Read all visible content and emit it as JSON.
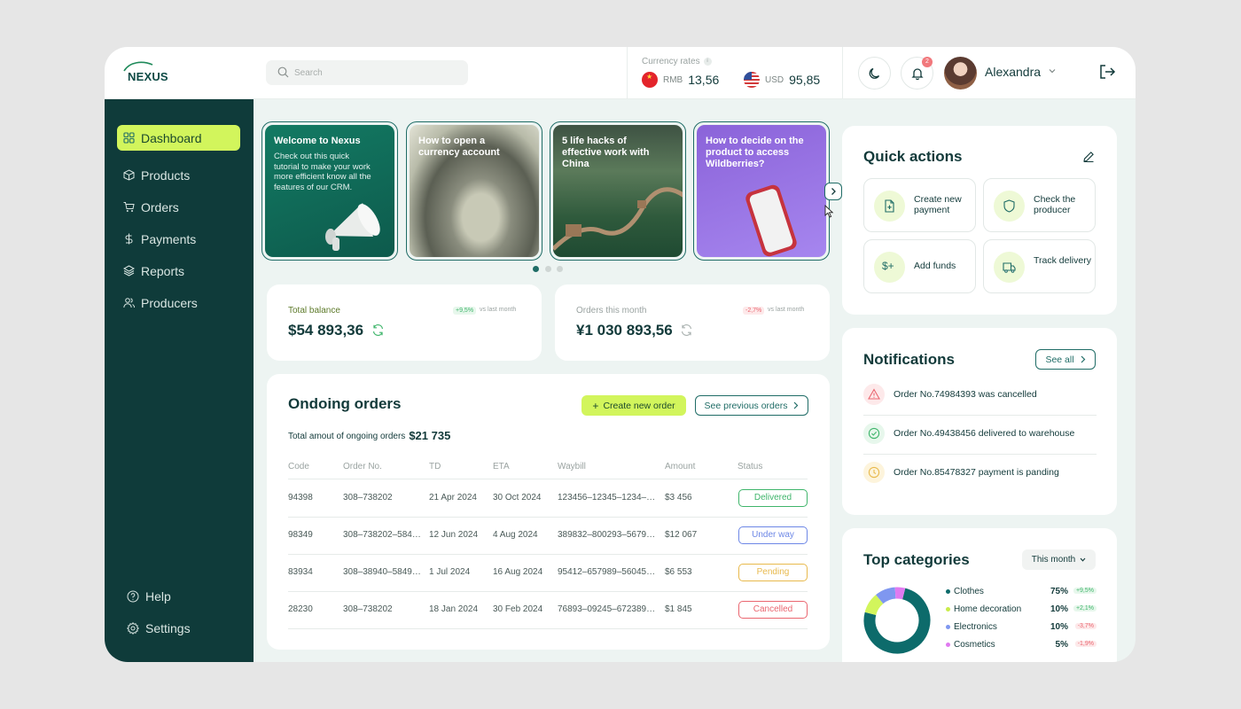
{
  "brand": {
    "name": "NEXUS",
    "accent": "#d2f55c",
    "sidebar_bg": "#0f3b3a",
    "primary": "#1f6c66"
  },
  "search": {
    "placeholder": "Search"
  },
  "currency": {
    "label": "Currency rates",
    "info_icon": "i",
    "rates": [
      {
        "code": "RMB",
        "value": "13,56",
        "flag": "china-flag-icon"
      },
      {
        "code": "USD",
        "value": "95,85",
        "flag": "usa-flag-icon"
      }
    ]
  },
  "header": {
    "notifications_count": "2",
    "user_name": "Alexandra"
  },
  "sidebar": {
    "items": [
      {
        "label": "Dashboard",
        "icon": "grid-icon",
        "active": true
      },
      {
        "label": "Products",
        "icon": "box-icon"
      },
      {
        "label": "Orders",
        "icon": "cart-icon"
      },
      {
        "label": "Payments",
        "icon": "dollar-icon"
      },
      {
        "label": "Reports",
        "icon": "layers-icon"
      },
      {
        "label": "Producers",
        "icon": "users-icon"
      }
    ],
    "bottom": [
      {
        "label": "Help",
        "icon": "help-icon"
      },
      {
        "label": "Settings",
        "icon": "gear-icon"
      }
    ]
  },
  "slides": [
    {
      "title": "Welcome to Nexus",
      "body": "Check out this quick tutorial to make your work more efficient know all the features of our CRM."
    },
    {
      "title": "How to open a currency account"
    },
    {
      "title": "5 life hacks of effective work with China"
    },
    {
      "title": "How to decide on the product to access Wildberries?"
    }
  ],
  "stats": {
    "balance": {
      "label": "Total balance",
      "delta": "+9,5%",
      "vs": "vs last month",
      "value": "$54 893,36"
    },
    "orders": {
      "label": "Orders this month",
      "delta": "-2,7%",
      "vs": "vs last month",
      "value": "¥1 030 893,56"
    }
  },
  "orders": {
    "title": "Ondoing orders",
    "create_label": "Create new order",
    "previous_label": "See previous orders",
    "total_label": "Total amout of ongoing orders",
    "total_value": "$21 735",
    "columns": [
      "Code",
      "Order No.",
      "TD",
      "ETA",
      "Waybill",
      "Amount",
      "Status"
    ],
    "rows": [
      {
        "code": "94398",
        "order_no": "308–738202",
        "td": "21 Apr 2024",
        "eta": "30 Oct 2024",
        "waybill": "123456–12345–1234–1…",
        "amount": "$3 456",
        "status": "Delivered"
      },
      {
        "code": "98349",
        "order_no": "308–738202–584…",
        "td": "12 Jun 2024",
        "eta": "4 Aug 2024",
        "waybill": "389832–800293–56798…",
        "amount": "$12 067",
        "status": "Under way"
      },
      {
        "code": "83934",
        "order_no": "308–38940–5849…",
        "td": "1 Jul 2024",
        "eta": "16 Aug 2024",
        "waybill": "95412–657989–56045–…",
        "amount": "$6 553",
        "status": "Pending"
      },
      {
        "code": "28230",
        "order_no": "308–738202",
        "td": "18 Jan 2024",
        "eta": "30 Feb 2024",
        "waybill": "76893–09245–672389–…",
        "amount": "$1 845",
        "status": "Cancelled"
      }
    ],
    "status_colors": {
      "Delivered": "#3fb56b",
      "Under way": "#6d87e6",
      "Pending": "#e8b94c",
      "Cancelled": "#ea6670"
    }
  },
  "quick_actions": {
    "title": "Quick actions",
    "items": [
      {
        "label": "Create new payment",
        "icon": "file-plus-icon"
      },
      {
        "label": "Check the producer",
        "icon": "shield-icon"
      },
      {
        "label": "Add funds",
        "icon": "dollar-plus-icon"
      },
      {
        "label": "Track delivery",
        "icon": "truck-icon"
      }
    ]
  },
  "notifications": {
    "title": "Notifications",
    "see_all": "See all",
    "items": [
      {
        "text": "Order No.74984393 was cancelled",
        "type": "warning"
      },
      {
        "text": "Order No.49438456 delivered to warehouse",
        "type": "success"
      },
      {
        "text": "Order No.85478327 payment is panding",
        "type": "pending"
      }
    ]
  },
  "top_categories": {
    "title": "Top categories",
    "period": "This month",
    "items": [
      {
        "name": "Clothes",
        "pct": "75%",
        "delta": "+9,5%",
        "color": "#0d6b6b",
        "value": 75,
        "up": true
      },
      {
        "name": "Home decoration",
        "pct": "10%",
        "delta": "+2,1%",
        "color": "#d2f55c",
        "value": 10,
        "up": true
      },
      {
        "name": "Electronics",
        "pct": "10%",
        "delta": "-3,7%",
        "color": "#7f97f0",
        "value": 10,
        "up": false
      },
      {
        "name": "Cosmetics",
        "pct": "5%",
        "delta": "-1,9%",
        "color": "#e07af0",
        "value": 5,
        "up": false
      }
    ]
  }
}
